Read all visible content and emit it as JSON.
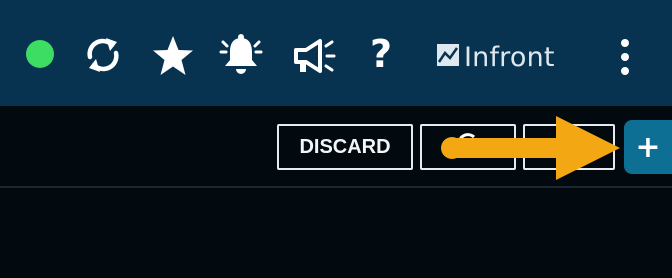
{
  "topbar": {
    "status": "online",
    "icons": [
      "status-dot",
      "refresh-icon",
      "star-icon",
      "bell-icon",
      "megaphone-icon",
      "help-icon",
      "more-vertical-icon"
    ],
    "help_label": "?",
    "logo_text": "Infront",
    "logo_icon": "chart-square-icon",
    "colors": {
      "bar": "#073350",
      "status": "#3ddc63",
      "icon": "#ffffff"
    }
  },
  "toolbar": {
    "discard_label": "DISCARD",
    "add_label": "+",
    "colors": {
      "add_button": "#0e6f94",
      "annotation_arrow": "#f3a712"
    }
  }
}
